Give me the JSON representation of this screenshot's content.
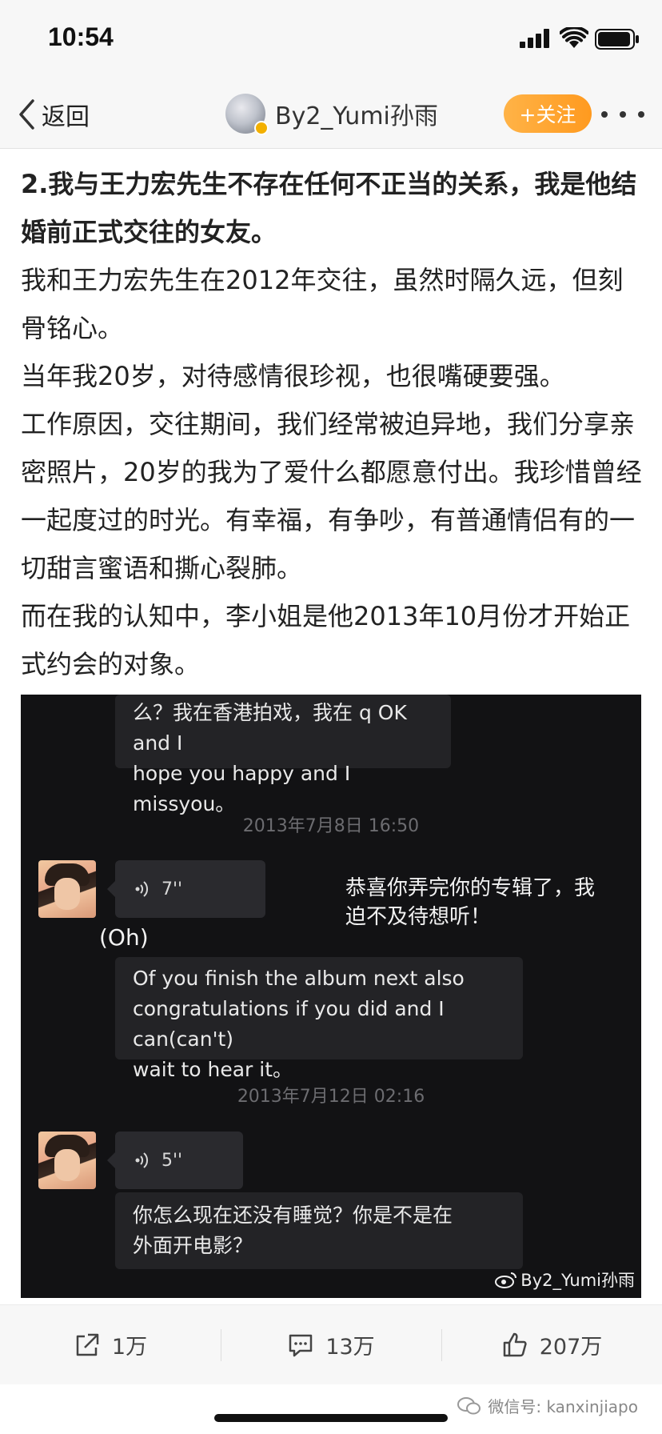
{
  "status_bar": {
    "time": "10:54",
    "icons": [
      "signal-icon",
      "wifi-icon",
      "battery-icon"
    ]
  },
  "nav": {
    "back_label": "返回",
    "username": "By2_Yumi孙雨",
    "follow_label": "+关注",
    "accent_color": "#ff9a1f"
  },
  "article": {
    "paragraphs": [
      {
        "text": "2.我与王力宏先生不存在任何不正当的关系，我是他结婚前正式交往的女友。",
        "bold": true
      },
      {
        "text": "我和王力宏先生在2012年交往，虽然时隔久远，但刻骨铭心。",
        "bold": false
      },
      {
        "text": "当年我20岁，对待感情很珍视，也很嘴硬要强。",
        "bold": false
      },
      {
        "text": "工作原因，交往期间，我们经常被迫异地，我们分享亲密照片，20岁的我为了爱什么都愿意付出。我珍惜曾经一起度过的时光。有幸福，有争吵，有普通情侣有的一切甜言蜜语和撕心裂肺。",
        "bold": false
      },
      {
        "text": "而在我的认知中，李小姐是他2013年10月份才开始正式约会的对象。",
        "bold": false
      }
    ]
  },
  "chat": {
    "top_bubble_line1": "么？我在香港拍戏，我在 q OK and I",
    "top_bubble_line2": "hope you happy and I missyou。",
    "ts1": "2013年7月8日 16:50",
    "voice1_duration": "7''",
    "overlay_cn_line1": "恭喜你弄完你的专辑了，我",
    "overlay_cn_line2": "迫不及待想听！",
    "overlay_oh": "(Oh)",
    "bubble2_line1": "Of you finish the album next also",
    "bubble2_line2": "congratulations if you did and I can(can't)",
    "bubble2_line3": "wait to hear it。",
    "ts2": "2013年7月12日 02:16",
    "voice2_duration": "5''",
    "bubble3_line1": "你怎么现在还没有睡觉？你是不是在",
    "bubble3_line2": "外面开电影？",
    "watermark": "By2_Yumi孙雨"
  },
  "actions": {
    "share_count": "1万",
    "comment_count": "13万",
    "like_count": "207万"
  },
  "footer": {
    "watermark": "微信号: kanxinjiapo"
  }
}
